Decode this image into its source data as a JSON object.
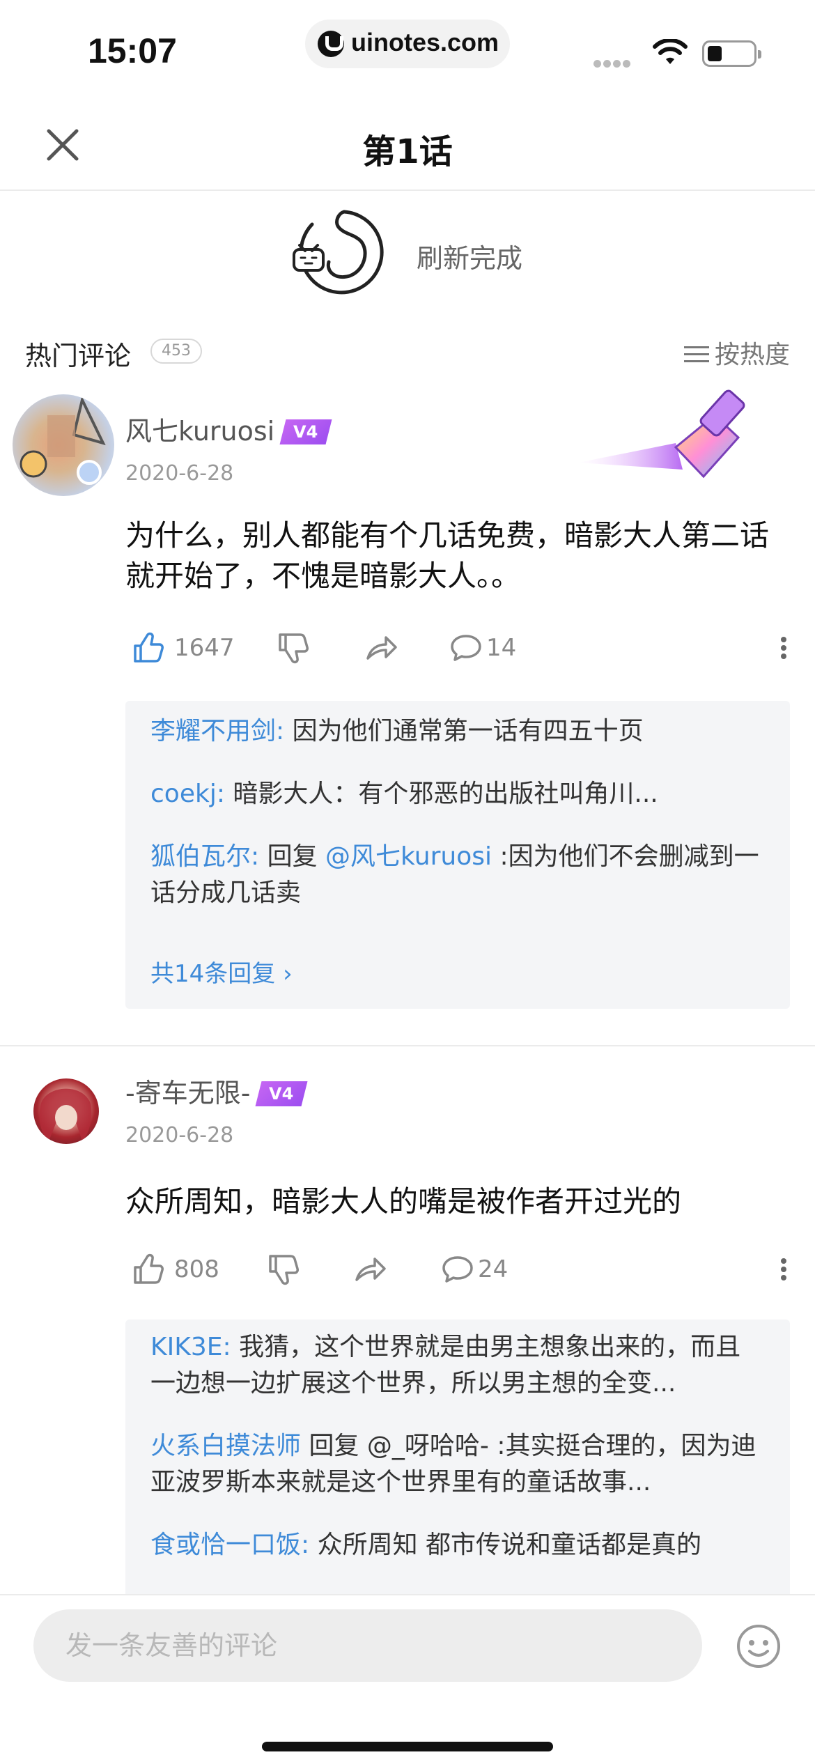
{
  "status_bar": {
    "time": "15:07",
    "url": "uinotes.com"
  },
  "nav": {
    "title": "第1话"
  },
  "refresh": {
    "text": "刷新完成"
  },
  "section": {
    "title": "热门评论",
    "count": "453",
    "sort_label": "按热度"
  },
  "comments": [
    {
      "username": "风七kuruosi",
      "level": "V4",
      "date": "2020-6-28",
      "content": "为什么，别人都能有个几话免费，暗影大人第二话就开始了，不愧是暗影大人。。",
      "likes": "1647",
      "replies_count": "14",
      "replies": [
        {
          "user": "李耀不用剑:",
          "text": " 因为他们通常第一话有四五十页"
        },
        {
          "user": "coekj:",
          "text": " 暗影大人：有个邪恶的出版社叫角川..."
        },
        {
          "user": "狐伯瓦尔:",
          "prefix": " 回复 ",
          "at": "@风七kuruosi",
          "text": " :因为他们不会删减到一话分成几话卖"
        }
      ],
      "more_replies": "共14条回复 ›"
    },
    {
      "username": "-寄车无限-",
      "level": "V4",
      "date": "2020-6-28",
      "content": "众所周知，暗影大人的嘴是被作者开过光的",
      "likes": "808",
      "replies_count": "24",
      "replies": [
        {
          "user": "KIK3E:",
          "text": " 我猜，这个世界就是由男主想象出来的，而且一边想一边扩展这个世界，所以男主想的全变..."
        },
        {
          "user": "火系白摸法师",
          "prefix": " 回复 ",
          "at": "@_呀哈哈-",
          "text": " :其实挺合理的，因为迪亚波罗斯本来就是这个世界里有的童话故事..."
        },
        {
          "user": "食或恰一口饭:",
          "text": " 众所周知 都市传说和童话都是真的"
        }
      ]
    }
  ],
  "bottom_bar": {
    "placeholder": "发一条友善的评论"
  },
  "colors": {
    "accent": "#3e8ad8",
    "vip": "#b35cf2",
    "like_active": "#3e8ad8"
  }
}
